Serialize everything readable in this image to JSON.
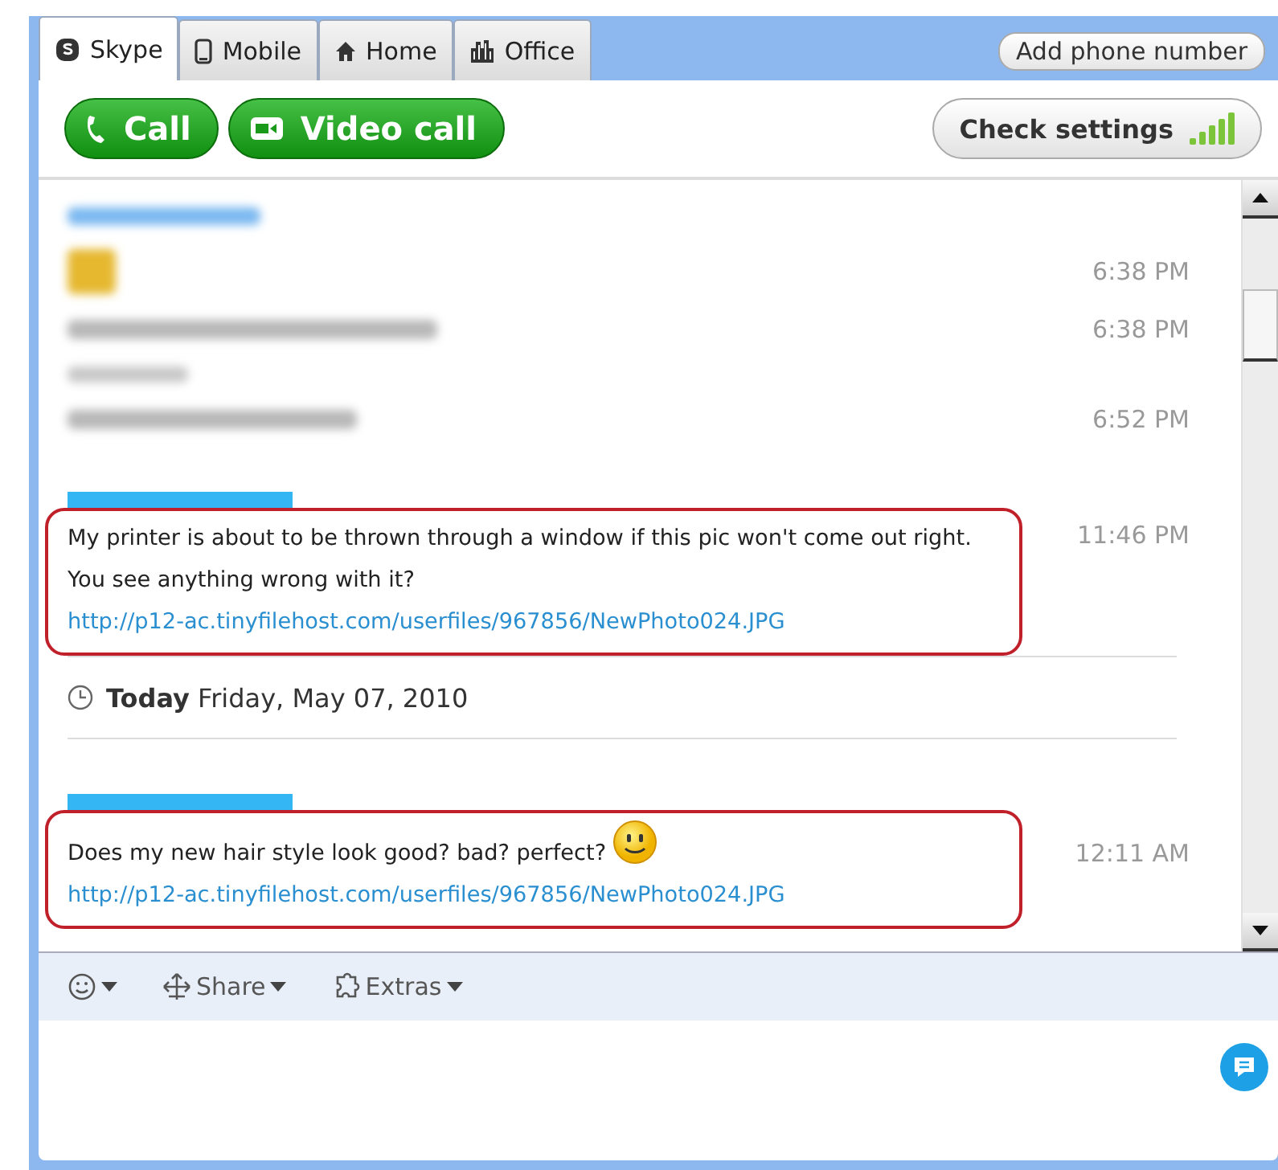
{
  "tabs": [
    {
      "label": "Skype",
      "selected": true
    },
    {
      "label": "Mobile",
      "selected": false
    },
    {
      "label": "Home",
      "selected": false
    },
    {
      "label": "Office",
      "selected": false
    }
  ],
  "add_phone_button": "Add phone number",
  "call_buttons": [
    "Call",
    "Video call"
  ],
  "check_settings_button": "Check settings",
  "conversation": [
    {
      "kind": "blurred_name"
    },
    {
      "kind": "blurred_emoji",
      "time": "6:38 PM"
    },
    {
      "kind": "blurred_text",
      "time": "6:38 PM"
    },
    {
      "kind": "blurred_subname"
    },
    {
      "kind": "blurred_text",
      "time": "6:52 PM"
    },
    {
      "kind": "redacted_name"
    },
    {
      "kind": "message",
      "highlighted": true,
      "text": "My printer is about to be thrown through a window if this pic won't come out right. You see anything wrong with it?",
      "link": "http://p12-ac.tinyfilehost.com/userfiles/967856/NewPhoto024.JPG",
      "emoji": false,
      "time": "11:46 PM"
    },
    {
      "kind": "date",
      "text": "**Today** Friday, May 07, 2010"
    },
    {
      "kind": "redacted_name"
    },
    {
      "kind": "message",
      "highlighted": true,
      "text": "Does my new hair style look good? bad? perfect?",
      "link": "http://p12-ac.tinyfilehost.com/userfiles/967856/NewPhoto024.JPG",
      "emoji": true,
      "time": "12:11 AM"
    }
  ],
  "toolbar": [
    {
      "kind": "emoticons"
    },
    {
      "kind": "share",
      "label": "Share"
    },
    {
      "kind": "extras",
      "label": "Extras"
    }
  ]
}
